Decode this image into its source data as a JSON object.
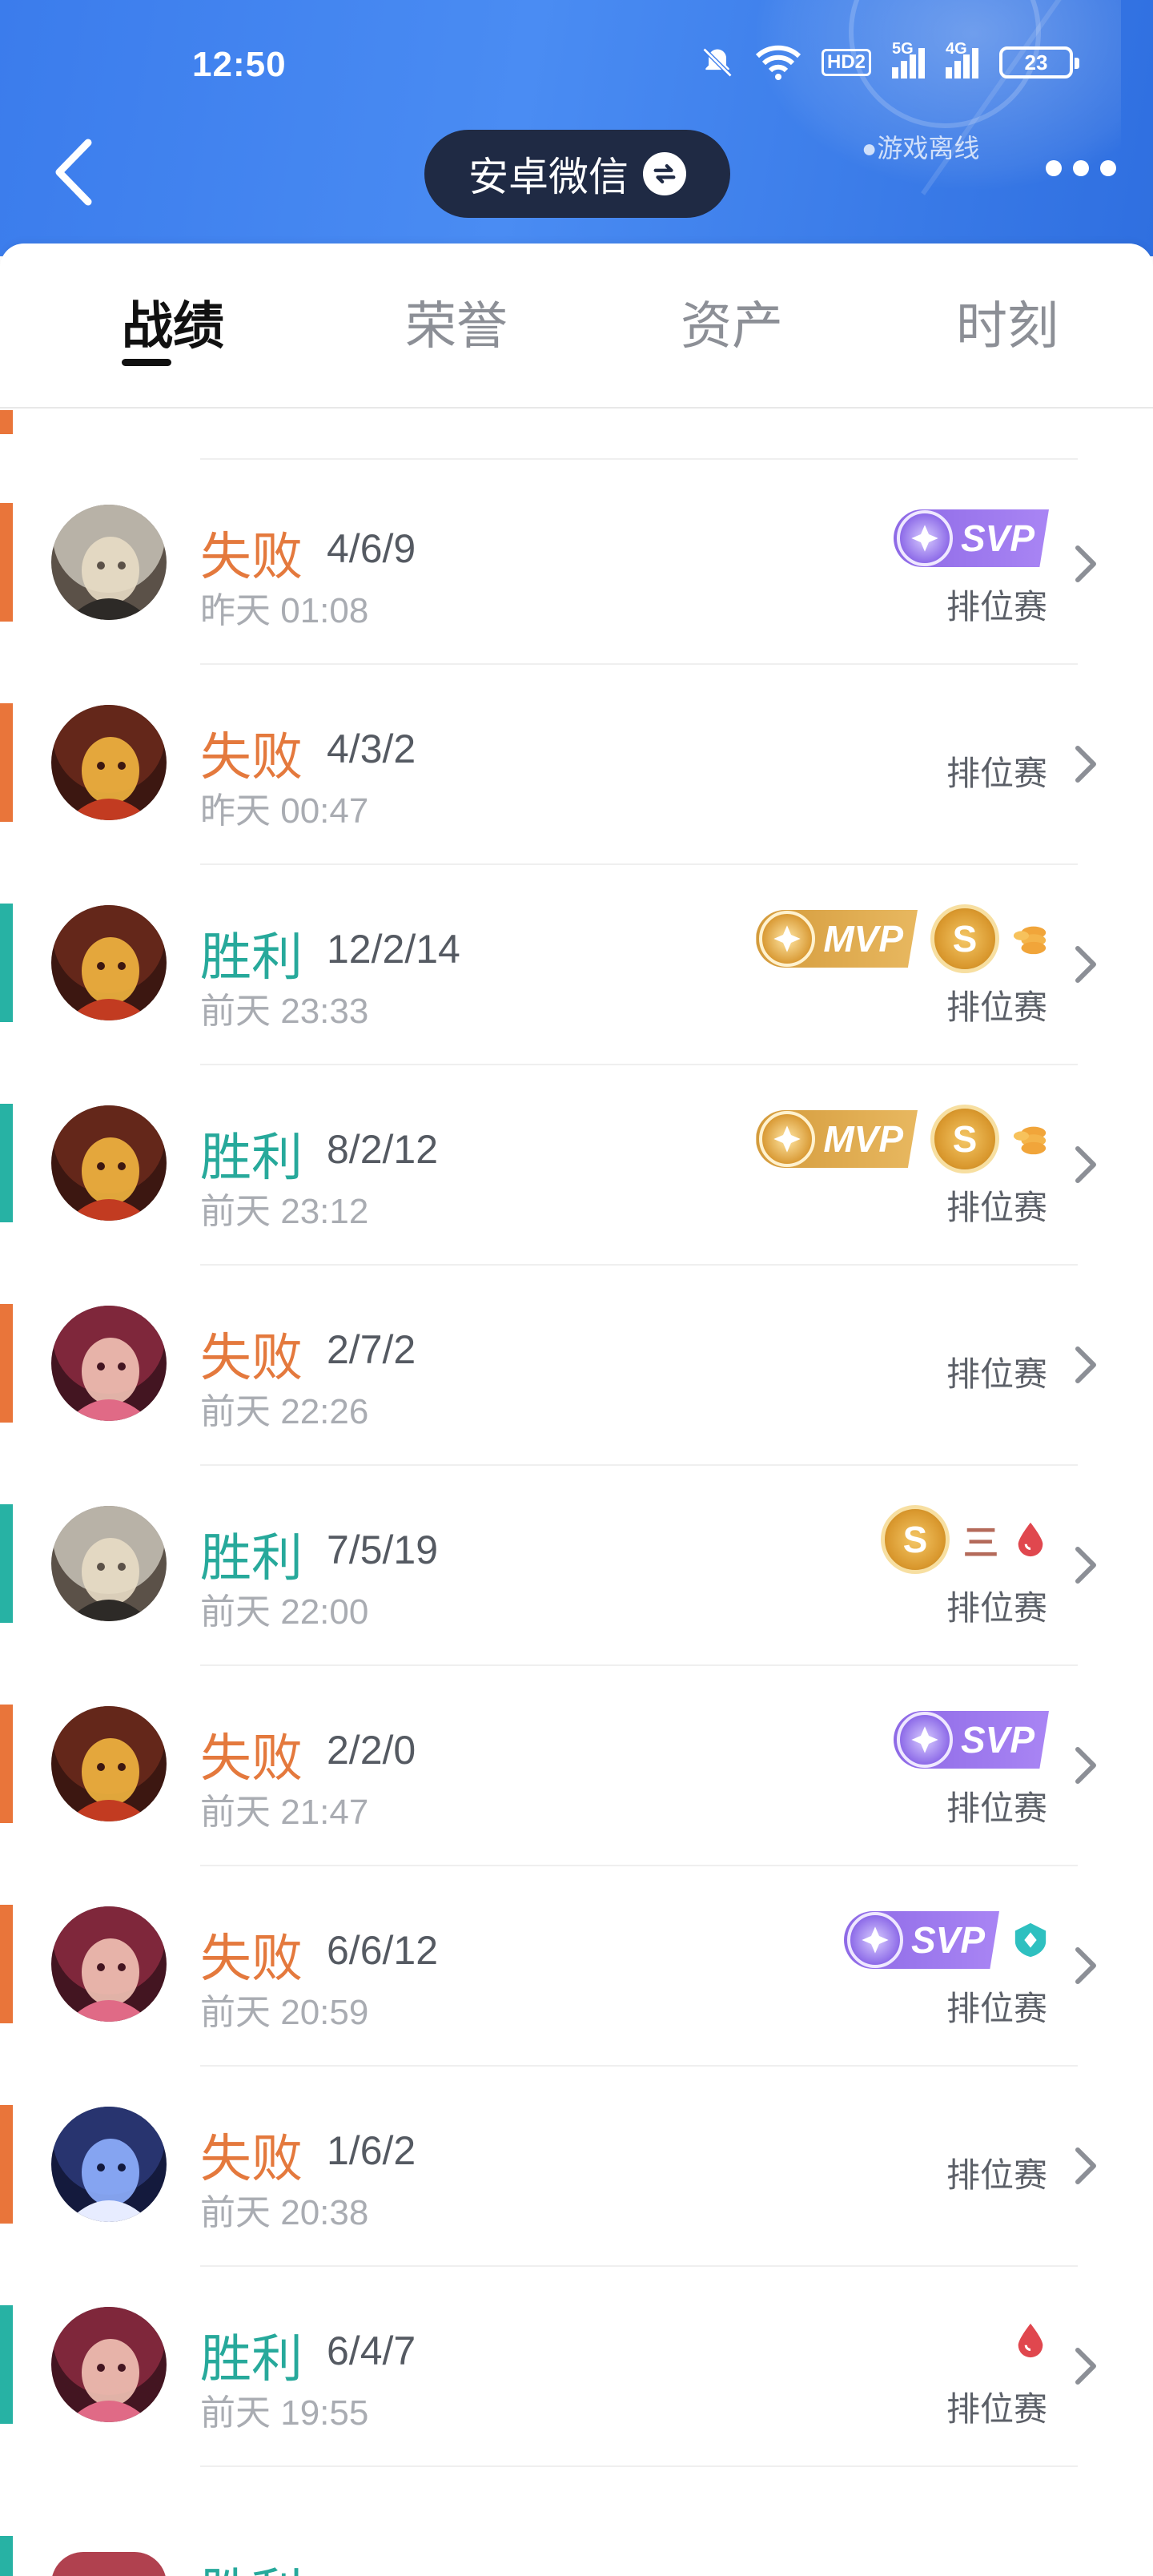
{
  "status_bar": {
    "time": "12:50",
    "battery": "23",
    "signal_labels": [
      "HD2",
      "5G",
      "4G"
    ]
  },
  "header": {
    "title": "安卓微信",
    "offline_status": "●游戏离线"
  },
  "tabs": [
    {
      "label": "战绩",
      "active": true
    },
    {
      "label": "荣誉",
      "active": false
    },
    {
      "label": "资产",
      "active": false
    },
    {
      "label": "时刻",
      "active": false
    }
  ],
  "colors": {
    "win": "#27a99b",
    "lose": "#e4793d",
    "header_blue": "#3b7cec",
    "pill_bg": "#1f2a44"
  },
  "matches": [
    {
      "result": "失败",
      "outcome": "lose",
      "kda": "4/6/9",
      "time": "昨天 01:08",
      "mode": "排位赛",
      "badges": [
        "svp"
      ],
      "hero": "hero-hooded"
    },
    {
      "result": "失败",
      "outcome": "lose",
      "kda": "4/3/2",
      "time": "昨天 00:47",
      "mode": "排位赛",
      "badges": [],
      "hero": "hero-monkey"
    },
    {
      "result": "胜利",
      "outcome": "win",
      "kda": "12/2/14",
      "time": "前天 23:33",
      "mode": "排位赛",
      "badges": [
        "mvp",
        "coin",
        "gold"
      ],
      "hero": "hero-monkey"
    },
    {
      "result": "胜利",
      "outcome": "win",
      "kda": "8/2/12",
      "time": "前天 23:12",
      "mode": "排位赛",
      "badges": [
        "mvp",
        "coin",
        "gold"
      ],
      "hero": "hero-monkey"
    },
    {
      "result": "失败",
      "outcome": "lose",
      "kda": "2/7/2",
      "time": "前天 22:26",
      "mode": "排位赛",
      "badges": [],
      "hero": "hero-redhair"
    },
    {
      "result": "胜利",
      "outcome": "win",
      "kda": "7/5/19",
      "time": "前天 22:00",
      "mode": "排位赛",
      "badges": [
        "coin",
        "triple",
        "blood"
      ],
      "hero": "hero-hooded"
    },
    {
      "result": "失败",
      "outcome": "lose",
      "kda": "2/2/0",
      "time": "前天 21:47",
      "mode": "排位赛",
      "badges": [
        "svp"
      ],
      "hero": "hero-monkey"
    },
    {
      "result": "失败",
      "outcome": "lose",
      "kda": "6/6/12",
      "time": "前天 20:59",
      "mode": "排位赛",
      "badges": [
        "svp",
        "shield"
      ],
      "hero": "hero-redhair"
    },
    {
      "result": "失败",
      "outcome": "lose",
      "kda": "1/6/2",
      "time": "前天 20:38",
      "mode": "排位赛",
      "badges": [],
      "hero": "hero-mage"
    },
    {
      "result": "胜利",
      "outcome": "win",
      "kda": "6/4/7",
      "time": "前天 19:55",
      "mode": "排位赛",
      "badges": [
        "blood"
      ],
      "hero": "hero-redhair"
    }
  ],
  "badge_labels": {
    "svp": "SVP",
    "mvp": "MVP",
    "coin": "S",
    "triple": "三"
  }
}
